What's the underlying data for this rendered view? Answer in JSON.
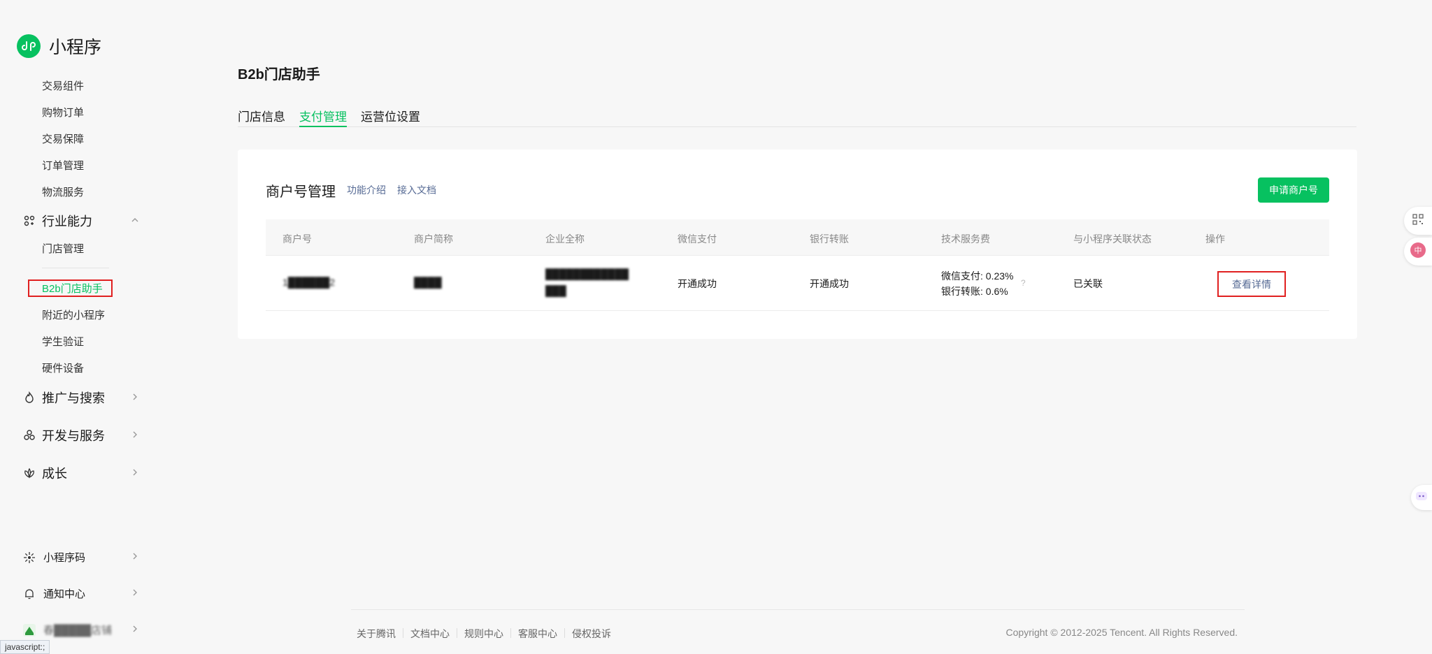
{
  "app": {
    "title": "小程序"
  },
  "sidebar": {
    "sub_items_top": [
      {
        "label": "交易组件"
      },
      {
        "label": "购物订单"
      },
      {
        "label": "交易保障"
      },
      {
        "label": "订单管理"
      },
      {
        "label": "物流服务"
      }
    ],
    "industry_group": {
      "label": "行业能力",
      "icon": "industry-icon"
    },
    "industry_items": [
      {
        "label": "门店管理"
      },
      {
        "label": "B2b门店助手"
      },
      {
        "label": "附近的小程序"
      },
      {
        "label": "学生验证"
      },
      {
        "label": "硬件设备"
      }
    ],
    "groups": [
      {
        "label": "推广与搜索",
        "icon": "flame-icon"
      },
      {
        "label": "开发与服务",
        "icon": "cluster-icon"
      },
      {
        "label": "成长",
        "icon": "lotus-icon"
      }
    ],
    "bottom": [
      {
        "label": "小程序码",
        "icon": "sun-code-icon"
      },
      {
        "label": "通知中心",
        "icon": "bell-icon"
      },
      {
        "label": "春█████店铺",
        "icon": "store-avatar"
      }
    ]
  },
  "main": {
    "title": "B2b门店助手",
    "tabs": [
      {
        "label": "门店信息"
      },
      {
        "label": "支付管理"
      },
      {
        "label": "运营位设置"
      }
    ],
    "card": {
      "title": "商户号管理",
      "links": [
        "功能介绍",
        "接入文档"
      ],
      "apply_button": "申请商户号"
    },
    "table": {
      "headers": [
        "商户号",
        "商户简称",
        "企业全称",
        "微信支付",
        "银行转账",
        "技术服务费",
        "与小程序关联状态",
        "操作"
      ],
      "rows": [
        {
          "merchant_id": "1██████2",
          "short_name": "████",
          "full_name_line1": "████████████",
          "full_name_line2": "███",
          "wechat_pay": "开通成功",
          "bank_transfer": "开通成功",
          "fee_wechat": "微信支付: 0.23%",
          "fee_bank": "银行转账: 0.6%",
          "link_status": "已关联",
          "action": "查看详情"
        }
      ]
    }
  },
  "footer": {
    "links": [
      "关于腾讯",
      "文档中心",
      "规则中心",
      "客服中心",
      "侵权投诉"
    ],
    "copyright": "Copyright © 2012-2025 Tencent. All Rights Reserved."
  },
  "status_bar": {
    "text": "javascript:;"
  },
  "colors": {
    "brand": "#07c160",
    "link": "#576b95",
    "highlight_box": "#e02020"
  }
}
